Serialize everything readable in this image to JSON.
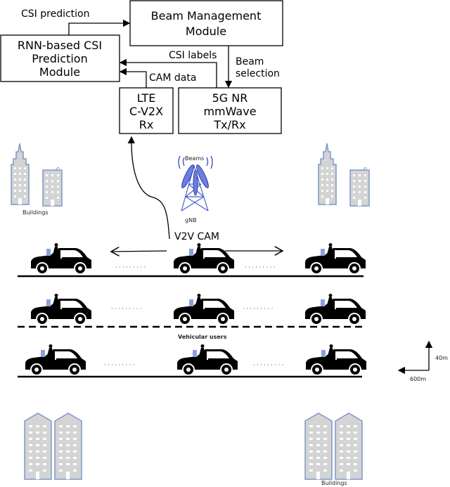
{
  "blocks": {
    "beam_management": [
      "Beam Management",
      "Module"
    ],
    "rnn": [
      "RNN-based CSI",
      "Prediction",
      "Module"
    ],
    "lte": [
      "LTE",
      "C-V2X",
      "Rx"
    ],
    "nr": [
      "5G NR",
      "mmWave",
      "Tx/Rx"
    ]
  },
  "arrows": {
    "csi_prediction": "CSI prediction",
    "csi_labels": "CSI labels",
    "cam_data": "CAM data",
    "beam_selection": [
      "Beam",
      "selection"
    ],
    "v2v_cam": "V2V CAM"
  },
  "scene": {
    "buildings_top": "Buildings",
    "buildings_bottom": "Buildings",
    "beams": "Beams",
    "gnb": "gNB",
    "vehicular_users": "Vehicular users",
    "scale_vertical": "40m",
    "scale_horizontal": "600m",
    "dots": "· · · · · · · · ·"
  },
  "colors": {
    "building_outline": "#7f96c8",
    "building_fill": "#d4d4d4",
    "beam": "#4a5fd0"
  }
}
